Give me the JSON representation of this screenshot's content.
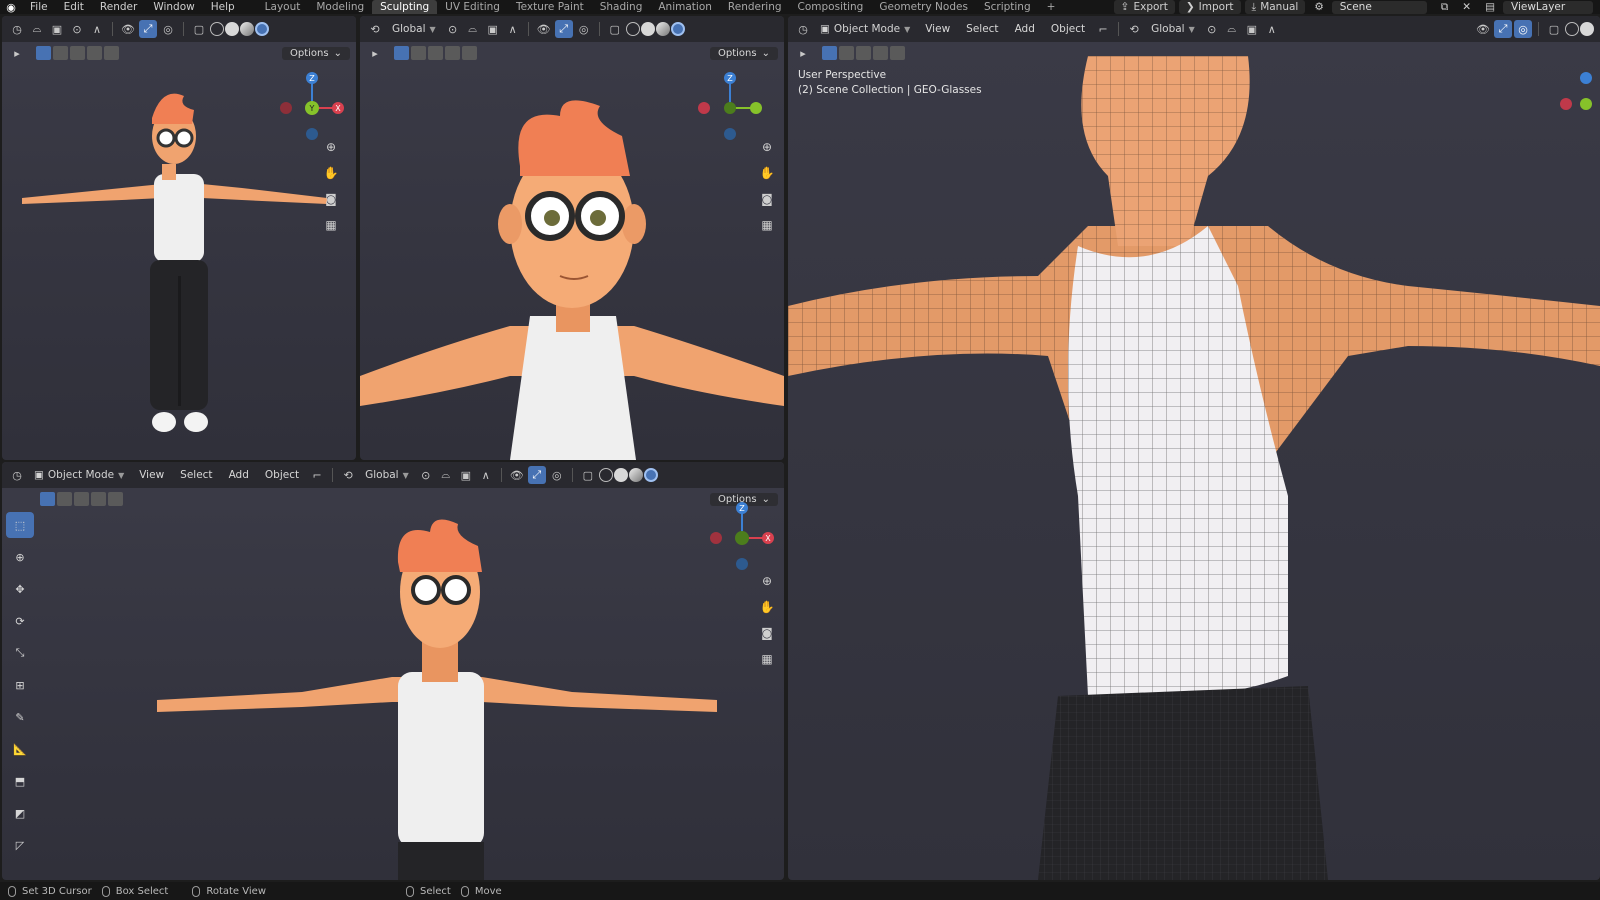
{
  "topbar": {
    "menus": [
      "File",
      "Edit",
      "Render",
      "Window",
      "Help"
    ],
    "workspace_tabs": [
      "Layout",
      "Modeling",
      "Sculpting",
      "UV Editing",
      "Texture Paint",
      "Shading",
      "Animation",
      "Rendering",
      "Compositing",
      "Geometry Nodes",
      "Scripting"
    ],
    "active_tab": "Sculpting",
    "add_tab": "+",
    "export_label": "Export",
    "import_label": "Import",
    "manual_label": "Manual",
    "scene_value": "Scene",
    "viewlayer_value": "ViewLayer"
  },
  "viewport_common": {
    "mode": "Object Mode",
    "view": "View",
    "select": "Select",
    "add": "Add",
    "object": "Object",
    "orientation": "Global",
    "options": "Options"
  },
  "viewport_right": {
    "perspective": "User Perspective",
    "collection": "(2) Scene Collection | GEO-Glasses"
  },
  "gizmo_labels": {
    "z": "Z",
    "y": "Y",
    "x": "X"
  },
  "status": {
    "set_cursor": "Set 3D Cursor",
    "box_select": "Box Select",
    "rotate_view": "Rotate View",
    "select": "Select",
    "move": "Move"
  },
  "colors": {
    "accent": "#4772b3",
    "gizmo_x": "#d9414f",
    "gizmo_y": "#86c22a",
    "gizmo_z": "#3c80d4",
    "skin": "#f0a36f",
    "hair": "#f07f54",
    "shirt": "#efefef",
    "pants": "#242427"
  }
}
